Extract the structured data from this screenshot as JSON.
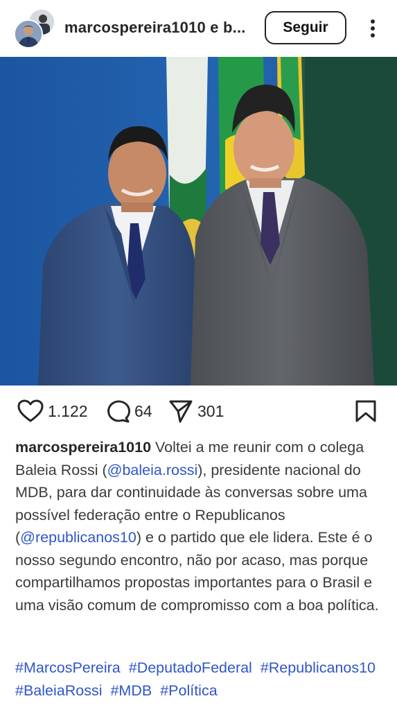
{
  "header": {
    "title": "marcospereira1010 e b...",
    "follow_label": "Seguir"
  },
  "icons": {
    "like": "heart-icon",
    "comment": "comment-bubble-icon",
    "share": "send-icon",
    "save": "bookmark-icon",
    "more": "more-options-icon"
  },
  "stats": {
    "likes": "1.122",
    "comments": "64",
    "shares": "301"
  },
  "caption": {
    "username": "marcospereira1010",
    "text_1": " Voltei a me reunir com o colega Baleia Rossi (",
    "mention_1": "@baleia.rossi",
    "text_2": "), presidente nacional do MDB, para dar continuidade às conversas sobre uma possível federação entre o Republicanos (",
    "mention_2": "@republicanos10",
    "text_3": ") e o partido que ele lidera. Este é o nosso segundo encontro, não por acaso, mas porque compartilhamos propostas importantes para o Brasil e uma visão comum de compromisso com a boa política."
  },
  "hashtags": [
    "#MarcosPereira",
    "#DeputadoFederal",
    "#Republicanos10",
    "#BaleiaRossi",
    "#MDB",
    "#Política"
  ],
  "colors": {
    "link": "#2f56c8",
    "backdrop": "#1f5aa6",
    "suit_left": "#34507e",
    "suit_right": "#5a5d61"
  }
}
